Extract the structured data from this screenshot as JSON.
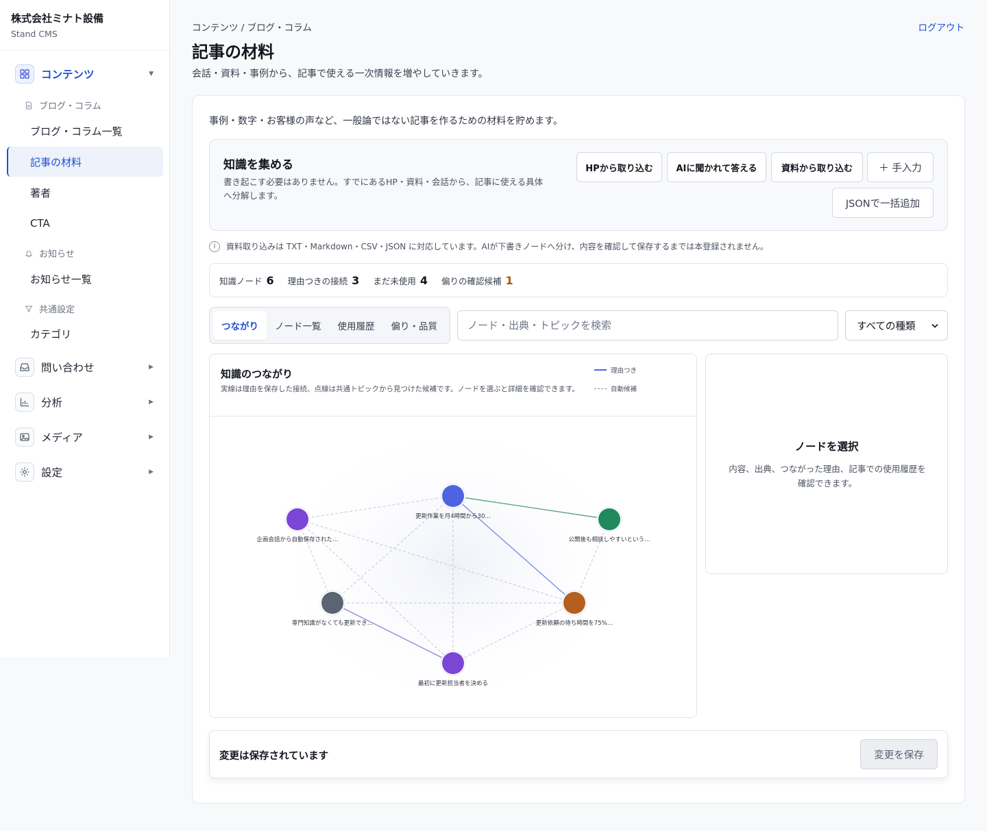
{
  "sidebar": {
    "org_name": "株式会社ミナト設備",
    "app_name": "Stand CMS",
    "contents_label": "コンテンツ",
    "groups": {
      "blog": "ブログ・コラム",
      "news": "お知らせ",
      "common": "共通設定"
    },
    "items": {
      "blog_list": "ブログ・コラム一覧",
      "materials": "記事の材料",
      "authors": "著者",
      "cta": "CTA",
      "news_list": "お知らせ一覧",
      "category": "カテゴリ"
    },
    "sections": {
      "inquiries": "問い合わせ",
      "analytics": "分析",
      "media": "メディア",
      "settings": "設定"
    }
  },
  "header": {
    "breadcrumb": "コンテンツ / ブログ・コラム",
    "logout": "ログアウト",
    "title": "記事の材料",
    "description": "会話・資料・事例から、記事で使える一次情報を増やしていきます。"
  },
  "main": {
    "intro": "事例・数字・お客様の声など、一般論ではない記事を作るための材料を貯めます。",
    "collect": {
      "title": "知識を集める",
      "description": "書き起こす必要はありません。すでにあるHP・資料・会話から、記事に使える具体へ分解します。",
      "buttons": {
        "from_hp": "HPから取り込む",
        "ai_interview": "AIに聞かれて答える",
        "from_docs": "資料から取り込む",
        "manual": "＋ 手入力",
        "json_bulk": "JSONで一括追加"
      }
    },
    "info_icon": "i",
    "info_text": "資料取り込みは TXT・Markdown・CSV・JSON に対応しています。AIが下書きノードへ分け、内容を確認して保存するまでは本登録されません。",
    "stats": [
      {
        "label": "知識ノード",
        "value": "6"
      },
      {
        "label": "理由つきの接続",
        "value": "3"
      },
      {
        "label": "まだ未使用",
        "value": "4"
      },
      {
        "label": "偏りの確認候補",
        "value": "1"
      }
    ],
    "tabs": [
      "つながり",
      "ノード一覧",
      "使用履歴",
      "偏り・品質"
    ],
    "search_placeholder": "ノード・出典・トピックを検索",
    "type_filter": "すべての種類",
    "graph": {
      "title": "知識のつながり",
      "description": "実線は理由を保存した接続、点線は共通トピックから見つけた候補です。ノードを選ぶと詳細を確認できます。",
      "legend_solid": "理由つき",
      "legend_dashed": "自動候補"
    },
    "detail": {
      "title": "ノードを選択",
      "description": "内容、出典、つながった理由、記事での使用履歴を確認できます。"
    },
    "savebar": {
      "status": "変更は保存されています",
      "button": "変更を保存"
    }
  },
  "colors": {
    "accent": "#1d4ed8",
    "warn": "#b45309",
    "node_blue": "#4f63e0",
    "node_purple": "#7b45d6",
    "node_green": "#1f8a5c",
    "node_gray": "#5b6472",
    "node_orange": "#b45f1f",
    "node_violet": "#7b45d6"
  },
  "icons": {
    "contents": "grid-icon",
    "blog_group": "document-icon",
    "news_group": "bell-icon",
    "common_group": "filter-icon",
    "inquiries": "inbox-icon",
    "analytics": "bar-chart-icon",
    "media": "image-icon",
    "settings": "gear-icon"
  },
  "knowledge_graph": {
    "nodes": [
      {
        "id": "n1",
        "label": "更新作業を月4時間から30…",
        "color": "#4f63e0"
      },
      {
        "id": "n2",
        "label": "企画会話から自動保存された…",
        "color": "#7b45d6"
      },
      {
        "id": "n3",
        "label": "公開後も相談しやすいという…",
        "color": "#1f8a5c"
      },
      {
        "id": "n4",
        "label": "専門知識がなくても更新でき…",
        "color": "#5b6472"
      },
      {
        "id": "n5",
        "label": "更新依頼の待ち時間を75%…",
        "color": "#b45f1f"
      },
      {
        "id": "n6",
        "label": "最初に更新担当者を決める",
        "color": "#7b45d6"
      }
    ],
    "edges": [
      {
        "from": "n1",
        "to": "n3",
        "kind": "reason",
        "color": "#5fa58a"
      },
      {
        "from": "n1",
        "to": "n5",
        "kind": "reason",
        "color": "#7b8fe0"
      },
      {
        "from": "n4",
        "to": "n6",
        "kind": "reason",
        "color": "#9b7fd6"
      },
      {
        "from": "n2",
        "to": "n1",
        "kind": "auto"
      },
      {
        "from": "n2",
        "to": "n4",
        "kind": "auto"
      },
      {
        "from": "n2",
        "to": "n5",
        "kind": "auto"
      },
      {
        "from": "n2",
        "to": "n6",
        "kind": "auto"
      },
      {
        "from": "n1",
        "to": "n4",
        "kind": "auto"
      },
      {
        "from": "n1",
        "to": "n6",
        "kind": "auto"
      },
      {
        "from": "n3",
        "to": "n5",
        "kind": "auto"
      },
      {
        "from": "n4",
        "to": "n5",
        "kind": "auto"
      },
      {
        "from": "n5",
        "to": "n6",
        "kind": "auto"
      }
    ]
  }
}
